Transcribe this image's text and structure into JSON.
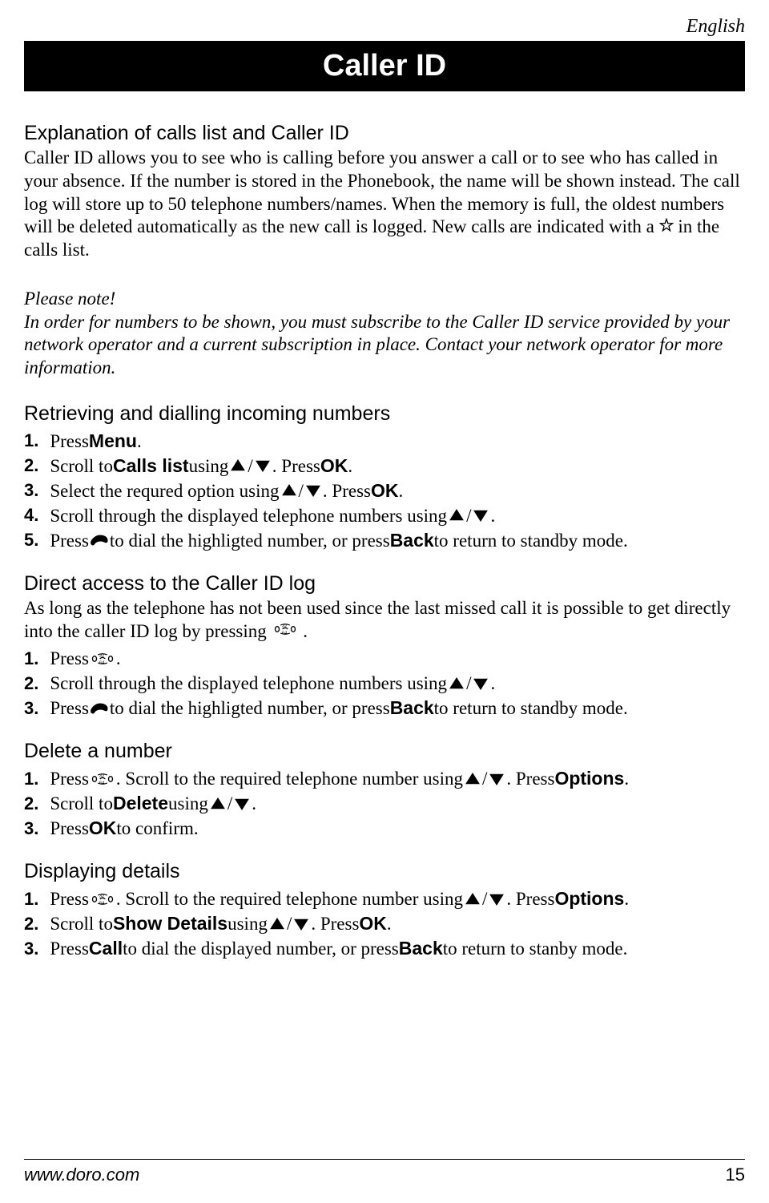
{
  "language_label": "English",
  "page_title": "Caller ID",
  "explanation": {
    "heading": "Explanation of calls list and Caller ID",
    "body_pre": "Caller ID allows you to see who is calling before you answer a call or to see who has called in your absence. If the number is stored in the Phonebook, the name will be shown instead. The call log will store up to 50 telephone numbers/names. When the memory is full, the oldest numbers will be deleted automatically as the new call is logged. New calls are indicated with a ",
    "body_post": " in the calls list."
  },
  "note": {
    "title": "Please note!",
    "body": "In order for numbers to be shown, you must subscribe to the Caller ID service provided by your network operator and a current subscription in place. Contact your network operator for more information."
  },
  "retrieving": {
    "heading": "Retrieving and dialling incoming numbers",
    "s1_a": "Press ",
    "s1_b": "Menu",
    "s1_c": ".",
    "s2_a": "Scroll to ",
    "s2_b": "Calls list",
    "s2_c": " using ",
    "s2_d": ". Press ",
    "s2_e": "OK",
    "s2_f": ".",
    "s3_a": "Select the requred option using ",
    "s3_b": ". Press ",
    "s3_c": "OK",
    "s3_d": ".",
    "s4_a": "Scroll through the displayed telephone numbers using ",
    "s4_b": ".",
    "s5_a": "Press ",
    "s5_b": " to dial the highligted number, or press ",
    "s5_c": "Back",
    "s5_d": " to return to standby mode."
  },
  "direct": {
    "heading": "Direct access to the Caller ID log",
    "intro_a": "As long as the telephone has not been used since the last missed call it is possible to get directly into the caller ID log by pressing ",
    "intro_b": ".",
    "s1_a": "Press ",
    "s1_b": ".",
    "s2_a": "Scroll through the displayed telephone numbers using ",
    "s2_b": ".",
    "s3_a": "Press ",
    "s3_b": " to dial the highligted number, or press ",
    "s3_c": "Back",
    "s3_d": " to return to standby mode."
  },
  "delete": {
    "heading": "Delete a number",
    "s1_a": "Press ",
    "s1_b": ". Scroll to the required telephone number using ",
    "s1_c": ". Press ",
    "s1_d": "Options",
    "s1_e": ".",
    "s2_a": "Scroll to ",
    "s2_b": "Delete",
    "s2_c": " using ",
    "s2_d": ".",
    "s3_a": "Press ",
    "s3_b": "OK",
    "s3_c": " to confirm."
  },
  "details": {
    "heading": "Displaying details",
    "s1_a": "Press ",
    "s1_b": ". Scroll to the required telephone number using ",
    "s1_c": ". Press ",
    "s1_d": "Options",
    "s1_e": ".",
    "s2_a": "Scroll to ",
    "s2_b": "Show Details",
    "s2_c": " using ",
    "s2_d": ". Press ",
    "s2_e": "OK",
    "s2_f": ".",
    "s3_a": "Press ",
    "s3_b": "Call",
    "s3_c": " to dial the displayed number, or press ",
    "s3_d": "Back",
    "s3_e": " to return to stanby mode."
  },
  "step_numbers": {
    "n1": "1.",
    "n2": "2.",
    "n3": "3.",
    "n4": "4.",
    "n5": "5."
  },
  "footer": {
    "url": "www.doro.com",
    "page_number": "15"
  }
}
